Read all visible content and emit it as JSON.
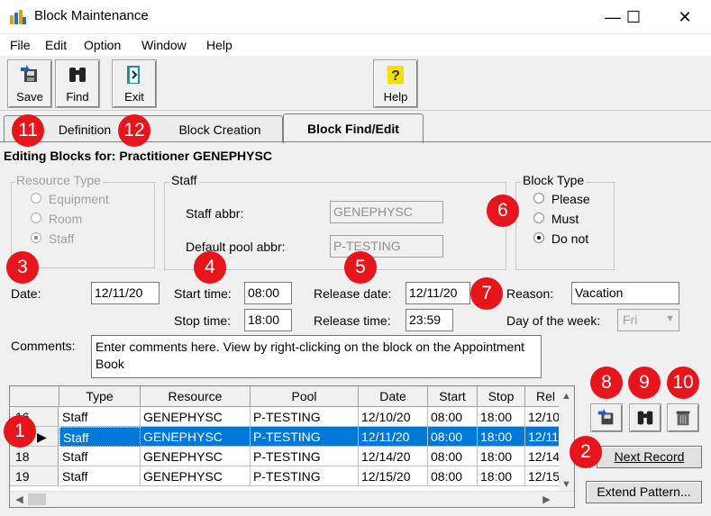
{
  "window": {
    "title": "Block Maintenance",
    "minimize": "—",
    "maximize": "☐",
    "close": "✕"
  },
  "menu": [
    "File",
    "Edit",
    "Option",
    "Window",
    "Help"
  ],
  "toolbar": {
    "save": "Save",
    "find": "Find",
    "exit": "Exit",
    "help": "Help"
  },
  "tabs": {
    "definition": "Definition",
    "block_creation": "Block Creation",
    "block_find_edit": "Block Find/Edit"
  },
  "editing_label": "Editing Blocks for:  Practitioner GENEPHYSC",
  "resource_type": {
    "title": "Resource Type",
    "options": [
      "Equipment",
      "Room",
      "Staff"
    ],
    "selected": "Staff"
  },
  "staff": {
    "title": "Staff",
    "abbr_label": "Staff abbr:",
    "abbr_value": "GENEPHYSC",
    "pool_label": "Default pool abbr:",
    "pool_value": "P-TESTING"
  },
  "block_type": {
    "title": "Block Type",
    "options": [
      "Please",
      "Must",
      "Do not"
    ],
    "selected": "Do not"
  },
  "form": {
    "date_label": "Date:",
    "date_value": "12/11/20",
    "start_label": "Start time:",
    "start_value": "08:00",
    "stop_label": "Stop time:",
    "stop_value": "18:00",
    "release_date_label": "Release date:",
    "release_date_value": "12/11/20",
    "release_time_label": "Release time:",
    "release_time_value": "23:59",
    "reason_label": "Reason:",
    "reason_value": "Vacation",
    "dow_label": "Day of the week:",
    "dow_value": "Fri",
    "comments_label": "Comments:",
    "comments_value": "Enter comments here. View by right-clicking on the block on the Appointment Book"
  },
  "grid": {
    "columns": [
      "Type",
      "Resource",
      "Pool",
      "Date",
      "Start",
      "Stop",
      "Rel"
    ],
    "rows": [
      {
        "num": "16",
        "cells": [
          "Staff",
          "GENEPHYSC",
          "P-TESTING",
          "12/10/20",
          "08:00",
          "18:00",
          "12/10"
        ]
      },
      {
        "num": "",
        "cells": [
          "Staff",
          "GENEPHYSC",
          "P-TESTING",
          "12/11/20",
          "08:00",
          "18:00",
          "12/11"
        ]
      },
      {
        "num": "18",
        "cells": [
          "Staff",
          "GENEPHYSC",
          "P-TESTING",
          "12/14/20",
          "08:00",
          "18:00",
          "12/14"
        ]
      },
      {
        "num": "19",
        "cells": [
          "Staff",
          "GENEPHYSC",
          "P-TESTING",
          "12/15/20",
          "08:00",
          "18:00",
          "12/15"
        ]
      }
    ],
    "selected_row": 1
  },
  "buttons": {
    "next_record": "Next Record",
    "extend_pattern": "Extend Pattern..."
  },
  "badges": {
    "b1": "1",
    "b2": "2",
    "b3": "3",
    "b4": "4",
    "b5": "5",
    "b6": "6",
    "b7": "7",
    "b8": "8",
    "b9": "9",
    "b10": "10",
    "b11": "11",
    "b12": "12"
  },
  "colors": {
    "badge": "#e8141b",
    "selection": "#0078d7"
  }
}
